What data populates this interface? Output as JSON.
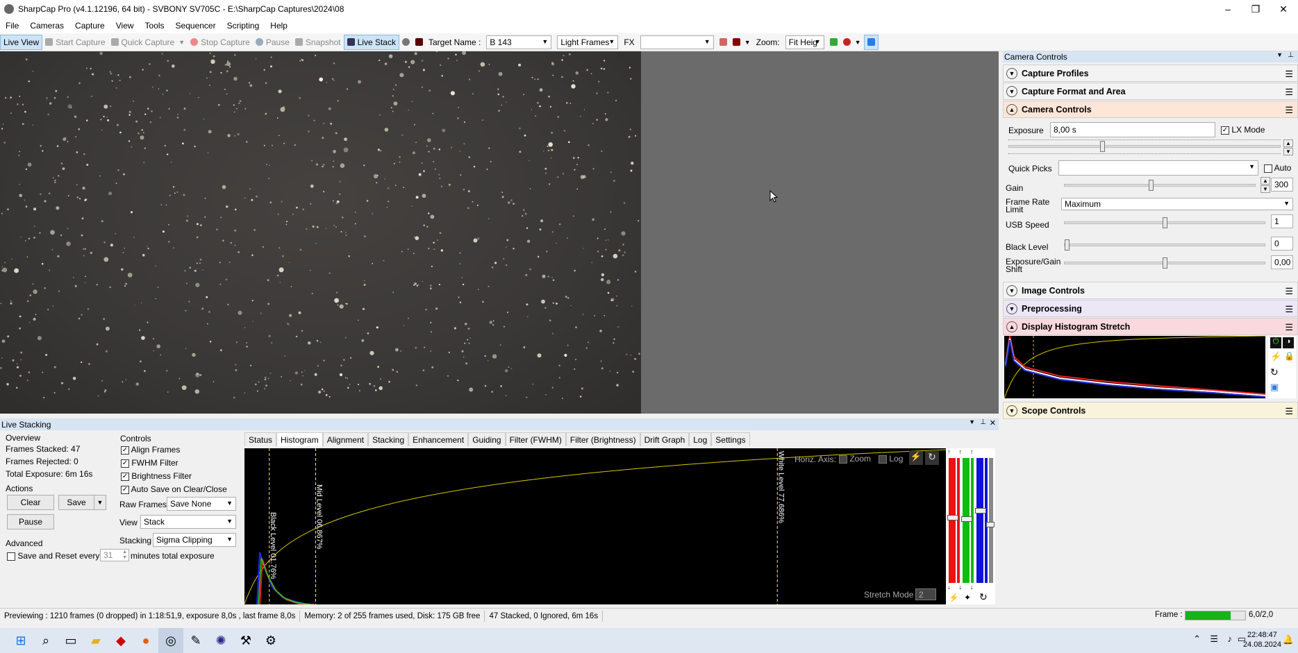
{
  "window": {
    "title": "SharpCap Pro (v4.1.12196, 64 bit) - SVBONY SV705C - E:\\SharpCap Captures\\2024\\08",
    "minimize": "–",
    "restore": "❐",
    "close": "✕"
  },
  "menu": [
    "File",
    "Cameras",
    "Capture",
    "View",
    "Tools",
    "Sequencer",
    "Scripting",
    "Help"
  ],
  "toolbar": {
    "live_view": "Live View",
    "start_capture": "Start Capture",
    "quick_capture": "Quick Capture",
    "stop_capture": "Stop Capture",
    "pause": "Pause",
    "snapshot": "Snapshot",
    "live_stack": "Live Stack",
    "target_name_label": "Target Name :",
    "target_name_value": "B 143",
    "frame_type": "Light Frames",
    "fx_label": "FX",
    "fx_value": "",
    "zoom_label": "Zoom:",
    "zoom_value": "Fit Heig"
  },
  "camera_controls": {
    "panel_title": "Camera Controls",
    "sections": {
      "capture_profiles": "Capture Profiles",
      "capture_format": "Capture Format and Area",
      "camera_controls": "Camera Controls",
      "image_controls": "Image Controls",
      "preprocessing": "Preprocessing",
      "display_histogram": "Display Histogram Stretch",
      "scope_controls": "Scope Controls"
    },
    "exposure_label": "Exposure",
    "exposure_value": "8,00 s",
    "lx_mode": "LX Mode",
    "quick_picks_label": "Quick Picks",
    "quick_picks_value": "",
    "auto": "Auto",
    "gain_label": "Gain",
    "gain_value": "300",
    "frame_rate_label": "Frame Rate Limit",
    "frame_rate_value": "Maximum",
    "usb_speed_label": "USB Speed",
    "usb_speed_value": "1",
    "black_level_label": "Black Level",
    "black_level_value": "0",
    "exposure_gain_shift_label": "Exposure/Gain Shift",
    "exposure_gain_shift_value": "0,00",
    "gain_level": 0.45,
    "usb_level": 0.5,
    "black_level_pos": 0.0,
    "shift_level": 0.5,
    "exposure_slider_level": 0.34
  },
  "live_stacking": {
    "panel_title": "Live Stacking",
    "overview_label": "Overview",
    "frames_stacked": "Frames Stacked:  47",
    "frames_rejected": "Frames Rejected: 0",
    "total_exposure": "Total Exposure:   6m 16s",
    "actions_label": "Actions",
    "clear": "Clear",
    "save": "Save",
    "pause": "Pause",
    "advanced_label": "Advanced",
    "save_reset_label": "Save and Reset every",
    "save_reset_value": "31",
    "minutes_label": "minutes total exposure",
    "controls_label": "Controls",
    "align_frames": "Align Frames",
    "fwhm_filter": "FWHM Filter",
    "brightness_filter": "Brightness Filter",
    "auto_save": "Auto Save on Clear/Close",
    "raw_frames_label": "Raw Frames",
    "raw_frames_value": "Save None",
    "view_label": "View",
    "view_value": "Stack",
    "stacking_label": "Stacking",
    "stacking_value": "Sigma Clipping",
    "tabs": [
      "Status",
      "Histogram",
      "Alignment",
      "Stacking",
      "Enhancement",
      "Guiding",
      "Filter (FWHM)",
      "Filter (Brightness)",
      "Drift Graph",
      "Log",
      "Settings"
    ],
    "histogram": {
      "horiz_axis": "Horiz. Axis:",
      "zoom": "Zoom",
      "log": "Log",
      "black_level": "Black Level 01.76%",
      "mid_level": "Mid Level 06.867%",
      "white_level": "White Level 77.686%",
      "stretch_mode_label": "Stretch Mode",
      "stretch_mode_value": "2",
      "black_level_pct": 1.76,
      "mid_level_pct": 6.867,
      "white_level_pct": 77.686
    }
  },
  "status": {
    "previewing": "Previewing : 1210 frames (0 dropped) in 1:18:51,9, exposure 8,0s , last frame 8,0s",
    "memory": "Memory: 2 of 255 frames used, Disk: 175 GB free",
    "stacked": "47 Stacked, 0 Ignored, 6m 16s",
    "frame_label": "Frame :",
    "frame_value": "6,0/2,0",
    "frame_progress": 0.75
  },
  "taskbar": {
    "time": "22:48:47",
    "date": "24.08.2024"
  },
  "colors": {
    "accent": "#cde4f7",
    "section_camera_controls": "#fde6d8",
    "section_preprocessing": "#ece6f7",
    "section_display_histogram": "#f9d9de",
    "section_scope": "#f9f3dc",
    "progress_green": "#16b31a"
  }
}
